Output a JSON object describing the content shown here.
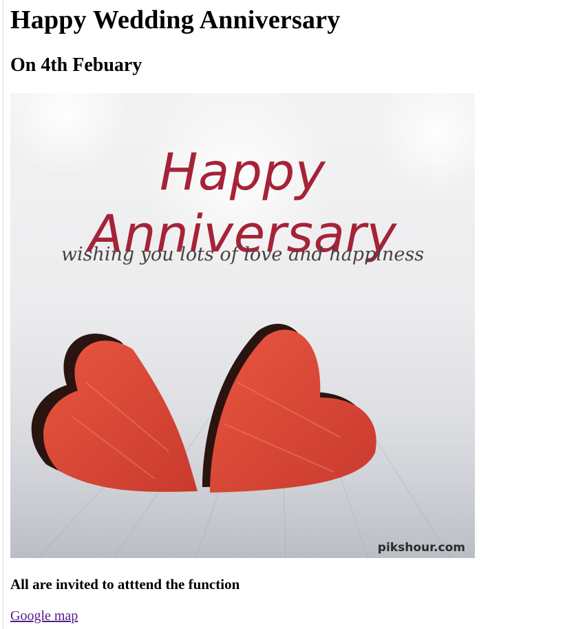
{
  "page": {
    "heading": "Happy Wedding Anniversary",
    "subheading": "On 4th Febuary"
  },
  "card_image": {
    "title": "Happy Anniversary",
    "subtitle": "wishing you lots of love and happiness",
    "watermark": "pikshour.com",
    "colors": {
      "title": "#a62337",
      "hearts": "#e0473a",
      "background": "#ececee"
    }
  },
  "invitation": {
    "text": "All are invited to atttend the function"
  },
  "link": {
    "label": "Google map",
    "color": "#551a8b"
  }
}
